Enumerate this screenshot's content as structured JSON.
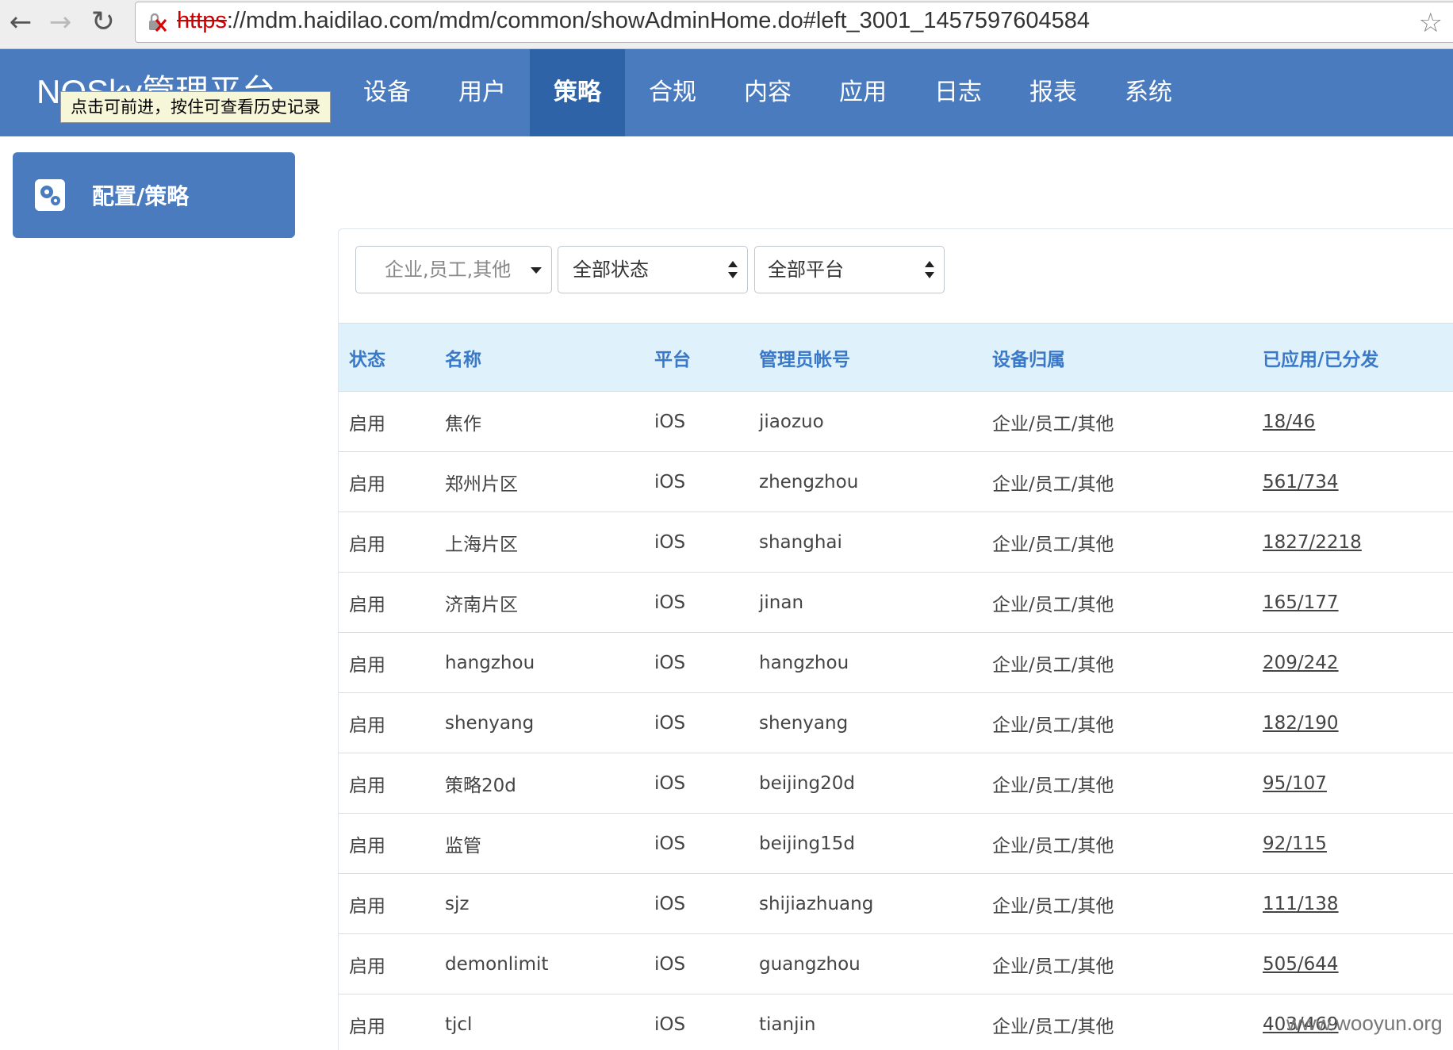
{
  "browser": {
    "url_scheme": "https",
    "url_rest": "://mdm.haidilao.com/mdm/common/showAdminHome.do#left_3001_1457597604584"
  },
  "header": {
    "brand": "NQSky管理平台",
    "tooltip": "点击可前进，按住可查看历史记录",
    "tabs": [
      {
        "label": "设备",
        "active": false
      },
      {
        "label": "用户",
        "active": false
      },
      {
        "label": "策略",
        "active": true
      },
      {
        "label": "合规",
        "active": false
      },
      {
        "label": "内容",
        "active": false
      },
      {
        "label": "应用",
        "active": false
      },
      {
        "label": "日志",
        "active": false
      },
      {
        "label": "报表",
        "active": false
      },
      {
        "label": "系统",
        "active": false
      }
    ]
  },
  "sidebar": {
    "item_label": "配置/策略",
    "icon": "gears-icon"
  },
  "filters": {
    "owner_placeholder": "企业,员工,其他",
    "status_value": "全部状态",
    "platform_value": "全部平台"
  },
  "table": {
    "headers": [
      "状态",
      "名称",
      "平台",
      "管理员帐号",
      "设备归属",
      "已应用/已分发"
    ],
    "rows": [
      [
        "启用",
        "焦作",
        "iOS",
        "jiaozuo",
        "企业/员工/其他",
        "18/46"
      ],
      [
        "启用",
        "郑州片区",
        "iOS",
        "zhengzhou",
        "企业/员工/其他",
        "561/734"
      ],
      [
        "启用",
        "上海片区",
        "iOS",
        "shanghai",
        "企业/员工/其他",
        "1827/2218"
      ],
      [
        "启用",
        "济南片区",
        "iOS",
        "jinan",
        "企业/员工/其他",
        "165/177"
      ],
      [
        "启用",
        "hangzhou",
        "iOS",
        "hangzhou",
        "企业/员工/其他",
        "209/242"
      ],
      [
        "启用",
        "shenyang",
        "iOS",
        "shenyang",
        "企业/员工/其他",
        "182/190"
      ],
      [
        "启用",
        "策略20d",
        "iOS",
        "beijing20d",
        "企业/员工/其他",
        "95/107"
      ],
      [
        "启用",
        "监管",
        "iOS",
        "beijing15d",
        "企业/员工/其他",
        "92/115"
      ],
      [
        "启用",
        "sjz",
        "iOS",
        "shijiazhuang",
        "企业/员工/其他",
        "111/138"
      ],
      [
        "启用",
        "demonlimit",
        "iOS",
        "guangzhou",
        "企业/员工/其他",
        "505/644"
      ],
      [
        "启用",
        "tjcl",
        "iOS",
        "tianjin",
        "企业/员工/其他",
        "403/469"
      ]
    ]
  },
  "watermark": "www.wooyun.org",
  "colors": {
    "header_bg": "#4a7bbf",
    "active_tab_bg": "#2f63a8",
    "table_head_bg": "#dff1fb",
    "table_head_text": "#3a78c8"
  }
}
